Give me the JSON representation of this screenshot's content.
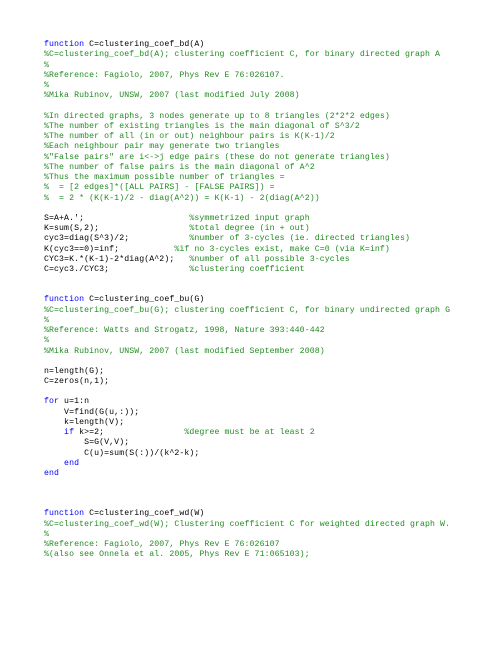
{
  "f1": {
    "sig_kw": "function",
    "sig_rest": " C=clustering_coef_bd(A)",
    "c1": "%C=clustering_coef_bd(A); clustering coefficient C, for binary directed graph A",
    "c2": "%",
    "c3": "%Reference: Fagiolo, 2007, Phys Rev E 76:026107.",
    "c4": "%",
    "c5": "%Mika Rubinov, UNSW, 2007 (last modified July 2008)",
    "c6": "%In directed graphs, 3 nodes generate up to 8 triangles (2*2*2 edges)",
    "c7": "%The number of existing triangles is the main diagonal of S^3/2",
    "c8": "%The number of all (in or out) neighbour pairs is K(K-1)/2",
    "c9": "%Each neighbour pair may generate two triangles",
    "c10": "%\"False pairs\" are i<->j edge pairs (these do not generate triangles)",
    "c11": "%The number of false pairs is the main diagonal of A^2",
    "c12": "%Thus the maximum possible number of triangles = ",
    "c13": "%  = [2 edges]*([ALL PAIRS] - [FALSE PAIRS]) = ",
    "c14": "%  = 2 * (K(K-1)/2 - diag(A^2)) = K(K-1) - 2(diag(A^2))",
    "l1a": "S=A+A.';                     ",
    "l1c": "%symmetrized input graph",
    "l2a": "K=sum(S,2);                  ",
    "l2c": "%total degree (in + out)",
    "l3a": "cyc3=diag(S^3)/2;            ",
    "l3c": "%number of 3-cycles (ie. directed triangles)",
    "l4a": "K(cyc3==0)=inf;           ",
    "l4c": "%if no 3-cycles exist, make C=0 (via K=inf)",
    "l5a": "CYC3=K.*(K-1)-2*diag(A^2);   ",
    "l5c": "%number of all possible 3-cycles",
    "l6a": "C=cyc3./CYC3;                ",
    "l6c": "%clustering coefficient"
  },
  "f2": {
    "sig_kw": "function",
    "sig_rest": " C=clustering_coef_bu(G)",
    "c1": "%C=clustering_coef_bu(G); clustering coefficient C, for binary undirected graph G",
    "c2": "%",
    "c3": "%Reference: Watts and Strogatz, 1998, Nature 393:440-442",
    "c4": "%",
    "c5": "%Mika Rubinov, UNSW, 2007 (last modified September 2008)",
    "l1": "n=length(G);",
    "l2": "C=zeros(n,1);",
    "for_kw": "for",
    "for_rest": " u=1:n",
    "l3": "    V=find(G(u,:));",
    "l4": "    k=length(V);",
    "if_kw": "    if",
    "if_rest": " k>=2;                ",
    "if_cm": "%degree must be at least 2",
    "l5": "        S=G(V,V);",
    "l6": "        C(u)=sum(S(:))/(k^2-k);",
    "end1": "    end",
    "end2": "end"
  },
  "f3": {
    "sig_kw": "function",
    "sig_rest": " C=clustering_coef_wd(W)",
    "c1": "%C=clustering_coef_wd(W); Clustering coefficient C for weighted directed graph W.",
    "c2": "%",
    "c3": "%Reference: Fagiolo, 2007, Phys Rev E 76:026107",
    "c4": "%(also see Onnela et al. 2005, Phys Rev E 71:065103);"
  }
}
